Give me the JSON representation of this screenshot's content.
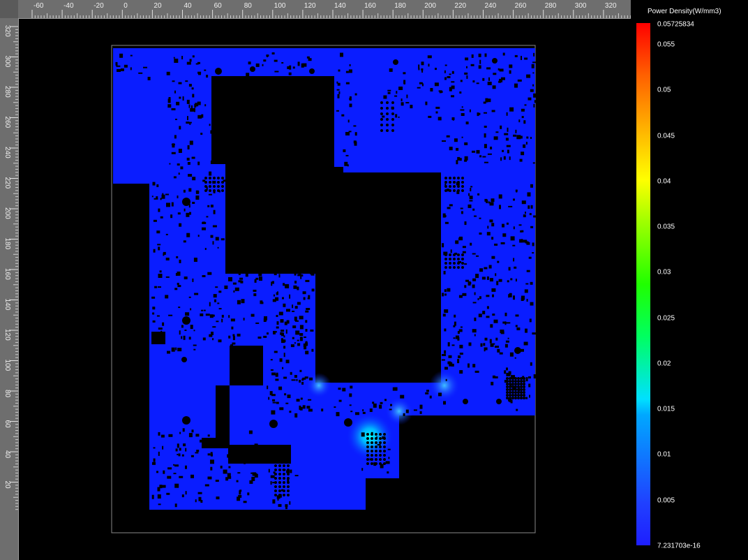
{
  "ruler": {
    "x_ticks": [
      "-60",
      "-40",
      "-20",
      "0",
      "20",
      "40",
      "60",
      "80",
      "100",
      "120",
      "140",
      "160",
      "180",
      "200",
      "220",
      "240",
      "260",
      "280",
      "300",
      "320"
    ],
    "y_ticks": [
      "320",
      "300",
      "280",
      "260",
      "240",
      "220",
      "200",
      "180",
      "160",
      "140",
      "120",
      "100",
      "80",
      "60",
      "40",
      "20"
    ]
  },
  "legend": {
    "title": "Power Density(W/mm3)",
    "labels": [
      "0.05725834",
      "0.055",
      "0.05",
      "0.045",
      "0.04",
      "0.035",
      "0.03",
      "0.025",
      "0.02",
      "0.015",
      "0.01",
      "0.005",
      "7.231703e-16"
    ]
  },
  "colors": {
    "board": "#0a1dff",
    "hotspot": "#00ffff",
    "background": "#000000",
    "ruler": "#6e6e6e"
  }
}
